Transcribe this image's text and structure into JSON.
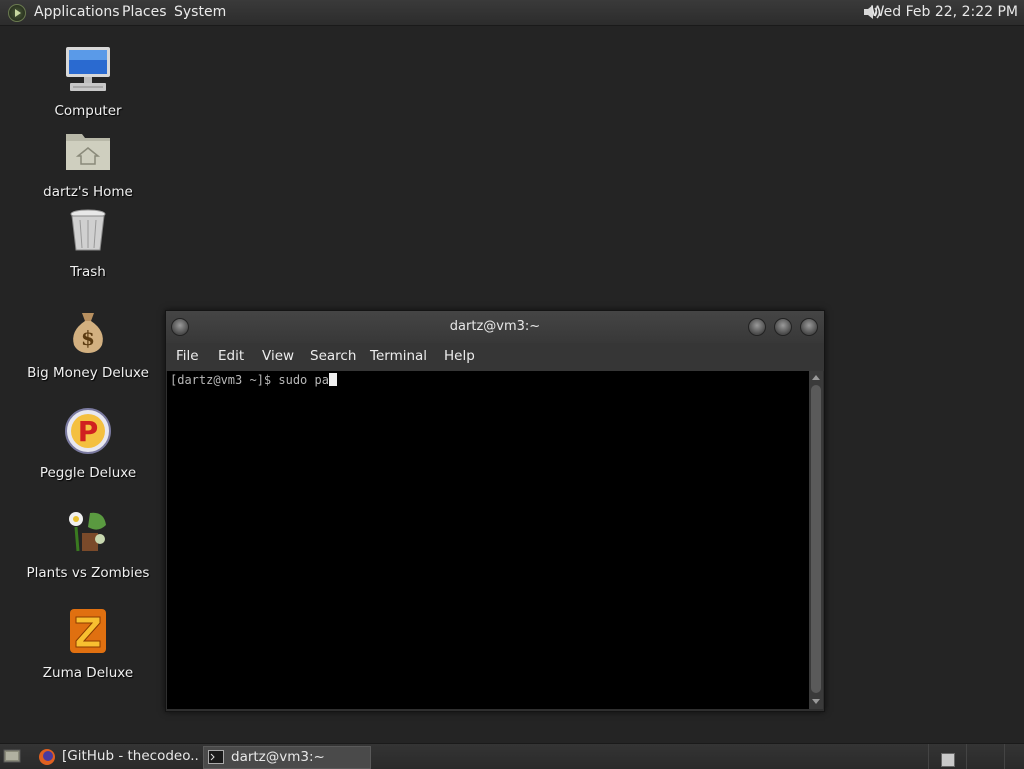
{
  "top_panel": {
    "menus": [
      "Applications",
      "Places",
      "System"
    ],
    "clock": "Wed Feb 22,  2:22 PM",
    "volume_icon": "speaker-icon"
  },
  "desktop": {
    "icons": [
      {
        "label": "Computer",
        "icon": "computer-icon"
      },
      {
        "label": "dartz's Home",
        "icon": "home-folder-icon"
      },
      {
        "label": "Trash",
        "icon": "trash-icon"
      },
      {
        "label": "Big Money Deluxe",
        "icon": "money-bag-icon"
      },
      {
        "label": "Peggle Deluxe",
        "icon": "peggle-icon"
      },
      {
        "label": "Plants vs Zombies",
        "icon": "plants-zombies-icon"
      },
      {
        "label": "Zuma Deluxe",
        "icon": "zuma-icon"
      }
    ]
  },
  "terminal": {
    "title": "dartz@vm3:~",
    "menu": [
      "File",
      "Edit",
      "View",
      "Search",
      "Terminal",
      "Help"
    ],
    "prompt_line": "[dartz@vm3 ~]$ sudo pa"
  },
  "bottom_panel": {
    "tasks": [
      {
        "label": "[GitHub - thecodeo...",
        "icon": "firefox-icon"
      },
      {
        "label": "dartz@vm3:~",
        "icon": "terminal-icon"
      }
    ]
  },
  "colors": {
    "desktop_bg": "#242424",
    "terminal_bg": "#000000",
    "panel_bg": "#2c2c2c"
  }
}
